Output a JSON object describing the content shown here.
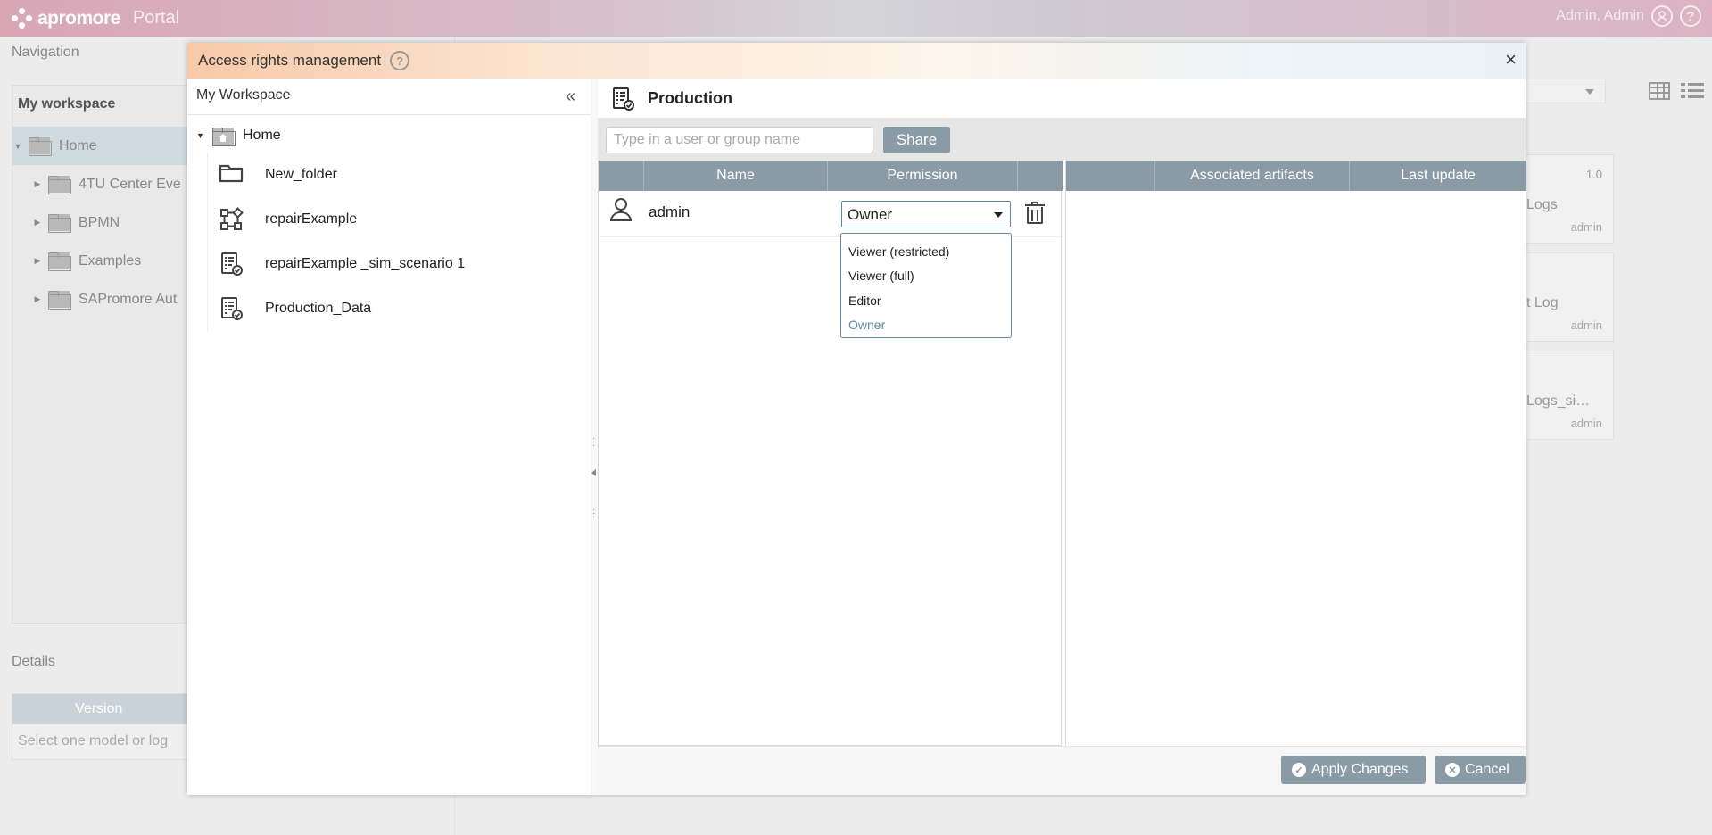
{
  "app": {
    "brand": "apromore",
    "product": "Portal",
    "user": "Admin, Admin",
    "user_icon": "user-circle-icon",
    "help_icon": "help-circle-icon"
  },
  "background": {
    "navigation_title": "Navigation",
    "workspace_title": "My workspace",
    "tree": [
      {
        "label": "Home",
        "selected": true
      },
      {
        "label": "4TU Center Eve"
      },
      {
        "label": "BPMN"
      },
      {
        "label": "Examples"
      },
      {
        "label": "SAPromore Aut"
      }
    ],
    "details_title": "Details",
    "details_column": "Version",
    "details_placeholder": "Select one model or log",
    "cards": [
      {
        "version": "1.0",
        "name": "Logs",
        "owner": "admin"
      },
      {
        "version": "",
        "name": "t Log",
        "owner": "admin"
      },
      {
        "version": "",
        "name": "Logs_si…",
        "owner": "admin"
      }
    ]
  },
  "modal": {
    "title": "Access rights management",
    "close": "×",
    "left": {
      "header": "My Workspace",
      "collapse": "«",
      "root": "Home",
      "items": [
        {
          "label": "New_folder",
          "icon": "folder-icon"
        },
        {
          "label": "repairExample",
          "icon": "process-model-icon"
        },
        {
          "label": "repairExample _sim_scenario 1",
          "icon": "event-log-icon"
        },
        {
          "label": "Production_Data",
          "icon": "event-log-icon"
        }
      ]
    },
    "right": {
      "title": "Production",
      "share_placeholder": "Type in a user or group name",
      "share_button": "Share",
      "columns": [
        "",
        "Name",
        "Permission",
        ""
      ],
      "artifact_columns": [
        "",
        "Associated artifacts",
        "Last update"
      ],
      "rows": [
        {
          "name": "admin",
          "permission": "Owner"
        }
      ],
      "permission_options": [
        "Viewer (restricted)",
        "Viewer (full)",
        "Editor",
        "Owner"
      ],
      "selected_option": "Owner"
    },
    "footer": {
      "apply": "Apply Changes",
      "cancel": "Cancel"
    }
  },
  "colors": {
    "accent": "#8a9ba6",
    "selection": "#5f89a6"
  }
}
